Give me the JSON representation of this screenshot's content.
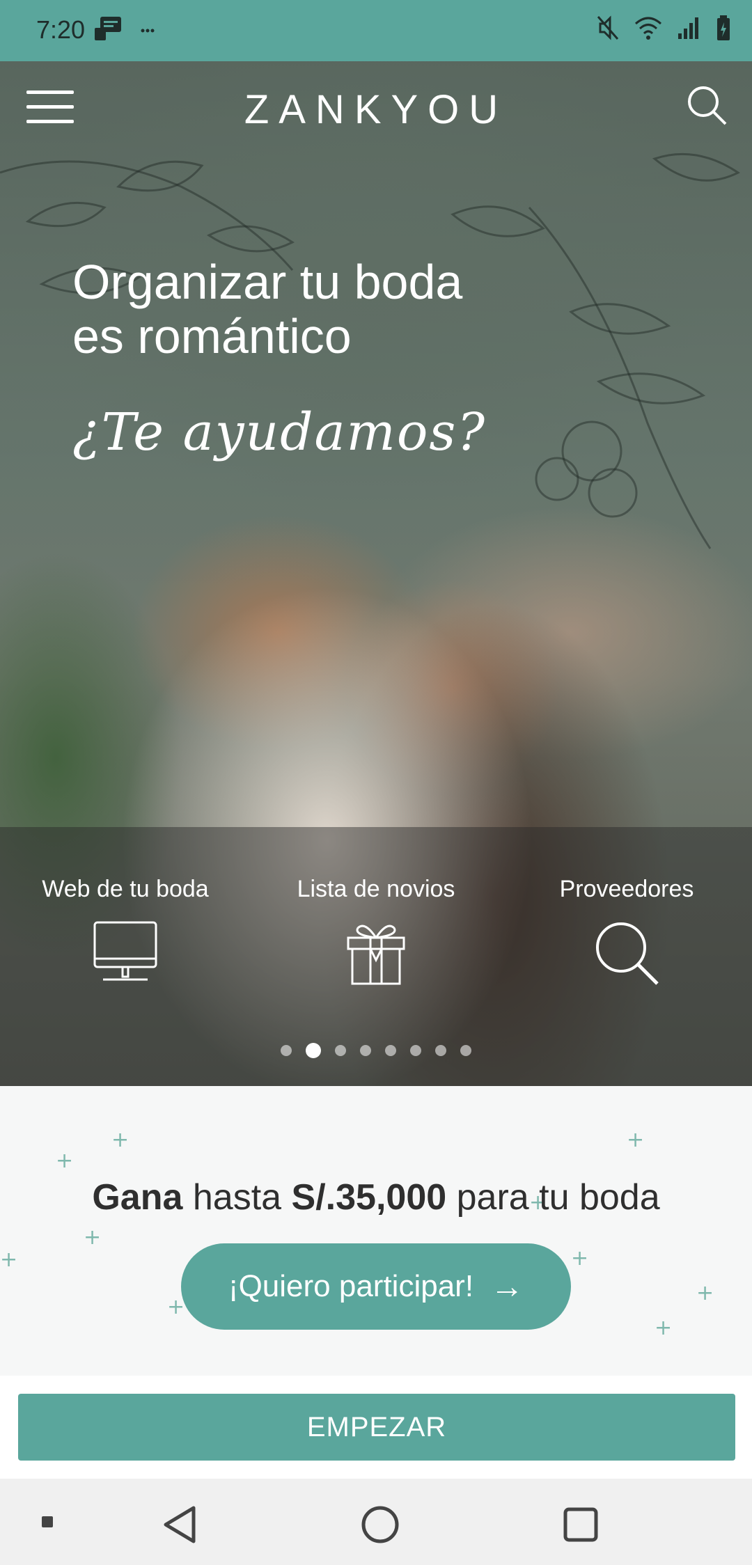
{
  "status_bar": {
    "time": "7:20",
    "left_icons": [
      "message-icon",
      "more-dots-icon"
    ],
    "right_icons": [
      "mute-icon",
      "wifi-icon",
      "signal-icon",
      "battery-icon"
    ]
  },
  "header": {
    "logo": "ZANKYOU",
    "menu_icon": "hamburger-menu-icon",
    "search_icon": "search-icon"
  },
  "hero": {
    "title_line1": "Organizar tu boda",
    "title_line2": "es romántico",
    "subtitle": "¿Te ayudamos?",
    "features": [
      {
        "label": "Web de tu boda",
        "icon": "monitor-icon"
      },
      {
        "label": "Lista de novios",
        "icon": "gift-icon"
      },
      {
        "label": "Proveedores",
        "icon": "search-icon"
      }
    ],
    "carousel": {
      "total": 8,
      "active_index": 1
    }
  },
  "promo": {
    "title_bold1": "Gana",
    "title_text1": " hasta ",
    "title_bold2": "S/.35,000",
    "title_text2": " para tu boda",
    "cta_label": "¡Quiero participar!",
    "cta_arrow": "→"
  },
  "footer": {
    "start_label": "EMPEZAR"
  },
  "nav_bar": {
    "items": [
      "menu-square-icon",
      "back-icon",
      "home-icon",
      "recents-icon"
    ]
  },
  "colors": {
    "accent": "#5aa69c",
    "promo_bg": "#f6f7f7",
    "navbar_bg": "#f0f0f0"
  }
}
